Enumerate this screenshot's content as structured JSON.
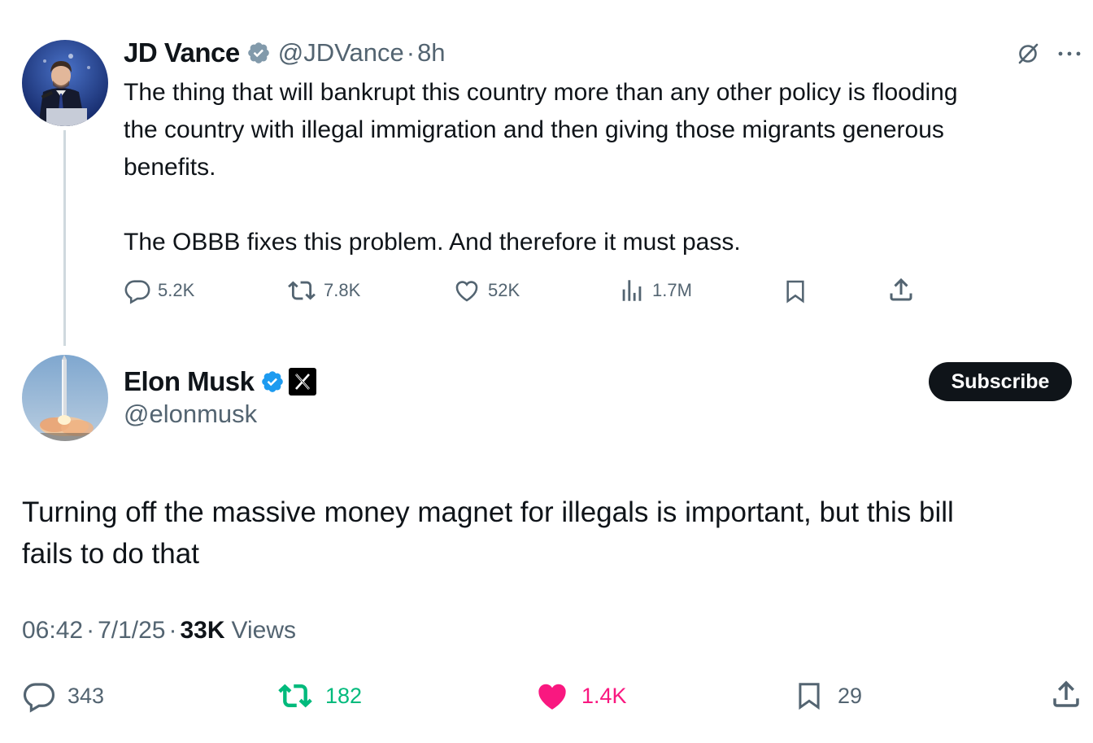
{
  "parent_tweet": {
    "author_name": "JD Vance",
    "handle": "@JDVance",
    "separator": "·",
    "time_ago": "8h",
    "text": "The thing that will bankrupt this country more than any other policy is flooding\nthe country with illegal immigration and then giving those migrants generous\nbenefits.\n\nThe OBBB fixes this problem. And therefore it must pass.",
    "replies": "5.2K",
    "reposts": "7.8K",
    "likes": "52K",
    "views": "1.7M",
    "icons": [
      "verified-badge-gray",
      "grok-icon",
      "more-icon",
      "reply-icon",
      "repost-icon",
      "like-icon",
      "views-icon",
      "bookmark-icon",
      "share-icon"
    ]
  },
  "main_tweet": {
    "author_name": "Elon Musk",
    "handle": "@elonmusk",
    "subscribe_label": "Subscribe",
    "text": "Turning off the massive money magnet for illegals is important, but this bill\nfails to do that",
    "time": "06:42",
    "date": "7/1/25",
    "separator": "·",
    "views_count": "33K",
    "views_label": "Views",
    "replies": "343",
    "reposts": "182",
    "likes": "1.4K",
    "bookmarks": "29",
    "colors": {
      "repost_active": "#00ba7c",
      "like_active": "#f91880",
      "verified_blue": "#1d9bf0"
    }
  }
}
